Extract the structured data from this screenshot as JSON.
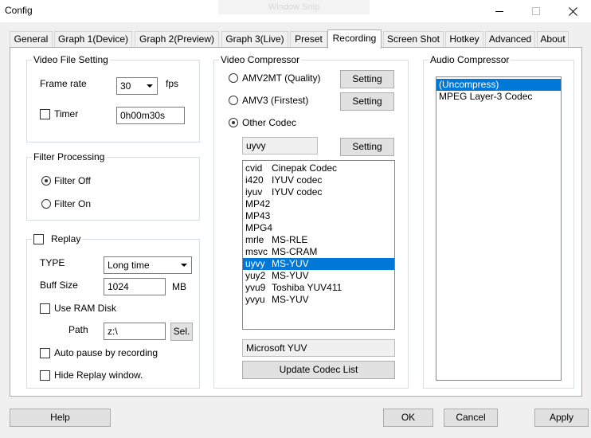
{
  "window": {
    "title": "Config",
    "ghost_caption": "Window Snip"
  },
  "tabs": [
    {
      "label": "General"
    },
    {
      "label": "Graph 1(Device)"
    },
    {
      "label": "Graph 2(Preview)"
    },
    {
      "label": "Graph 3(Live)"
    },
    {
      "label": "Preset"
    },
    {
      "label": "Recording",
      "active": true
    },
    {
      "label": "Screen Shot"
    },
    {
      "label": "Hotkey"
    },
    {
      "label": "Advanced"
    },
    {
      "label": "About"
    }
  ],
  "video_file_setting": {
    "title": "Video File Setting",
    "frame_rate_label": "Frame rate",
    "frame_rate_value": "30",
    "fps_label": "fps",
    "timer_label": "Timer",
    "timer_checked": false,
    "timer_value": "0h00m30s"
  },
  "filter_processing": {
    "title": "Filter Processing",
    "filter_off_label": "Filter Off",
    "filter_on_label": "Filter On",
    "selected": "Filter Off"
  },
  "replay": {
    "title": "Replay",
    "checked": false,
    "type_label": "TYPE",
    "type_value": "Long time",
    "buff_size_label": "Buff Size",
    "buff_size_value": "1024",
    "buff_unit": "MB",
    "use_ram_disk_label": "Use RAM Disk",
    "path_label": "Path",
    "path_value": "z:\\",
    "sel_button": "Sel.",
    "auto_pause_label": "Auto pause by recording",
    "hide_window_label": "Hide Replay window."
  },
  "video_compressor": {
    "title": "Video Compressor",
    "options": [
      {
        "label": "AMV2MT (Quality)",
        "selected": false
      },
      {
        "label": "AMV3 (Firstest)",
        "selected": false
      },
      {
        "label": "Other Codec",
        "selected": true
      }
    ],
    "setting_label": "Setting",
    "codec_fourcc": "uyvy",
    "codecs": [
      {
        "code": "cvid",
        "name": "Cinepak Codec"
      },
      {
        "code": "i420",
        "name": "IYUV codec"
      },
      {
        "code": "iyuv",
        "name": "IYUV codec"
      },
      {
        "code": "MP42",
        "name": ""
      },
      {
        "code": "MP43",
        "name": ""
      },
      {
        "code": "MPG4",
        "name": ""
      },
      {
        "code": "mrle",
        "name": "MS-RLE"
      },
      {
        "code": "msvc",
        "name": "MS-CRAM"
      },
      {
        "code": "uyvy",
        "name": "MS-YUV",
        "selected": true
      },
      {
        "code": "yuy2",
        "name": "MS-YUV"
      },
      {
        "code": "yvu9",
        "name": "Toshiba YUV411"
      },
      {
        "code": "yvyu",
        "name": "MS-YUV"
      }
    ],
    "codec_description": "Microsoft YUV",
    "update_button": "Update Codec List"
  },
  "audio_compressor": {
    "title": "Audio Compressor",
    "items": [
      {
        "label": "(Uncompress)",
        "selected": true
      },
      {
        "label": "MPEG Layer-3 Codec",
        "selected": false
      }
    ]
  },
  "buttons": {
    "help": "Help",
    "ok": "OK",
    "cancel": "Cancel",
    "apply": "Apply"
  },
  "colors": {
    "selection": "#0078d7",
    "panel": "#ffffff",
    "dialog": "#f0f0f0"
  }
}
